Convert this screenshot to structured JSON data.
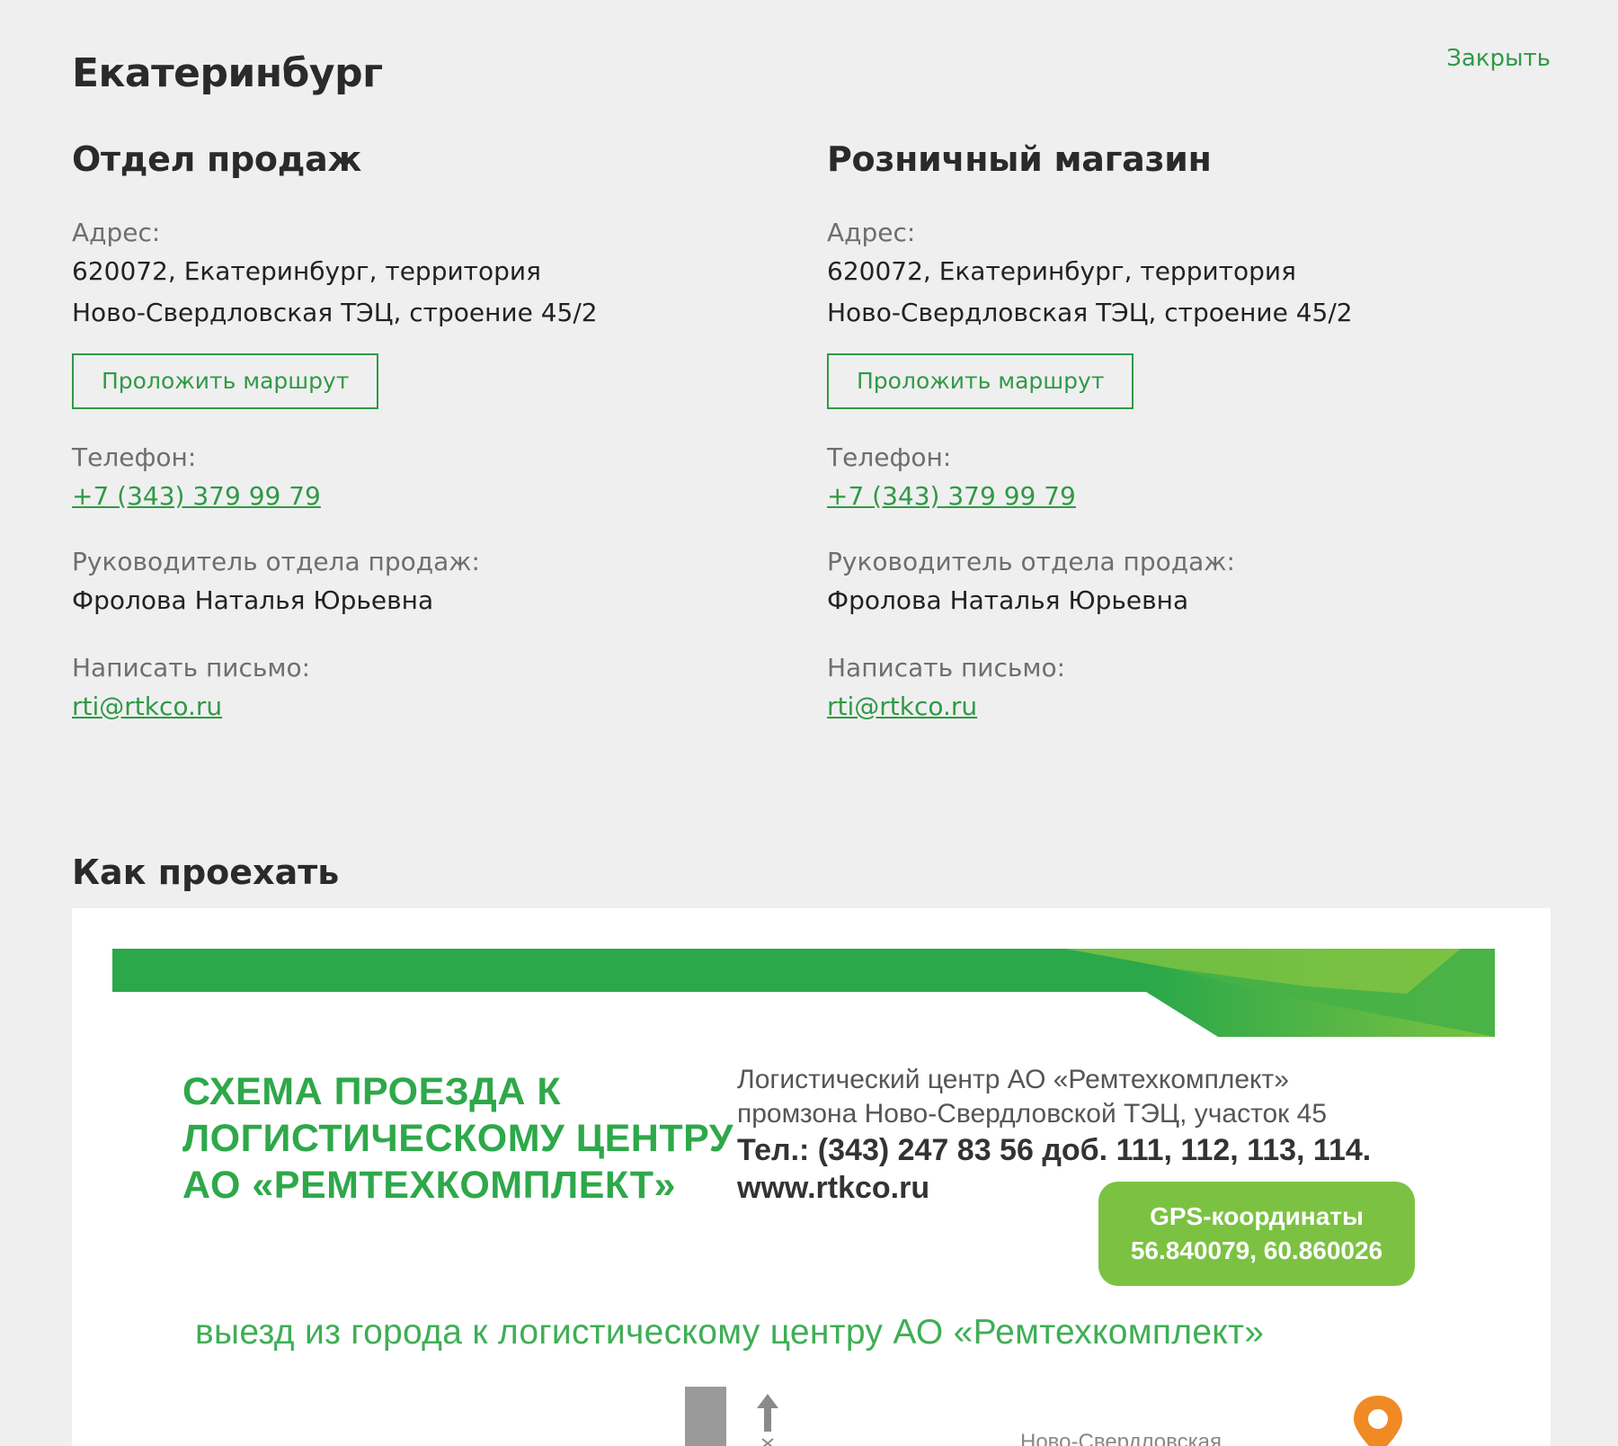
{
  "header": {
    "city": "Екатеринбург",
    "close_label": "Закрыть"
  },
  "sales": {
    "title": "Отдел продаж",
    "address_label": "Адрес:",
    "address_line1": "620072, Екатеринбург, территория",
    "address_line2": "Ново-Свердловская ТЭЦ, строение 45/2",
    "route_label": "Проложить маршрут",
    "phone_label": "Телефон:",
    "phone": "+7 (343) 379 99 79",
    "manager_label": "Руководитель отдела продаж:",
    "manager": "Фролова Наталья Юрьевна",
    "email_label": "Написать письмо:",
    "email": "rti@rtkco.ru"
  },
  "retail": {
    "title": "Розничный магазин",
    "address_label": "Адрес:",
    "address_line1": "620072, Екатеринбург, территория",
    "address_line2": "Ново-Свердловская ТЭЦ, строение 45/2",
    "route_label": "Проложить маршрут",
    "phone_label": "Телефон:",
    "phone": "+7 (343) 379 99 79",
    "manager_label": "Руководитель отдела продаж:",
    "manager": "Фролова Наталья Юрьевна",
    "email_label": "Написать письмо:",
    "email": "rti@rtkco.ru"
  },
  "directions": {
    "title": "Как проехать",
    "map": {
      "scheme_title_line1": "СХЕМА ПРОЕЗДА К",
      "scheme_title_line2": "ЛОГИСТИЧЕСКОМУ ЦЕНТРУ",
      "scheme_title_line3": "АО «РЕМТЕХКОМПЛЕКТ»",
      "center_line1": "Логистический центр АО «Ремтехкомплект»",
      "center_line2": "промзона Ново-Свердловской ТЭЦ, участок 45",
      "phone_line": "Тел.: (343) 247 83 56 доб. 111, 112, 113, 114.",
      "website": "www.rtkco.ru",
      "gps_label": "GPS-координаты",
      "gps_value": "56.840079, 60.860026",
      "exit_text": "выезд из города к логистическому центру АО «Ремтехкомплект»",
      "street_partial": "Ново-Свердловская"
    }
  },
  "colors": {
    "accent": "#2f9a45",
    "page_bg": "#f0eff0",
    "banner_green": "#2aa84a",
    "banner_light": "#7cc242",
    "pin_orange": "#f08a24"
  },
  "icons": {
    "arrow": "arrow-up-icon",
    "pin": "map-pin-icon"
  }
}
